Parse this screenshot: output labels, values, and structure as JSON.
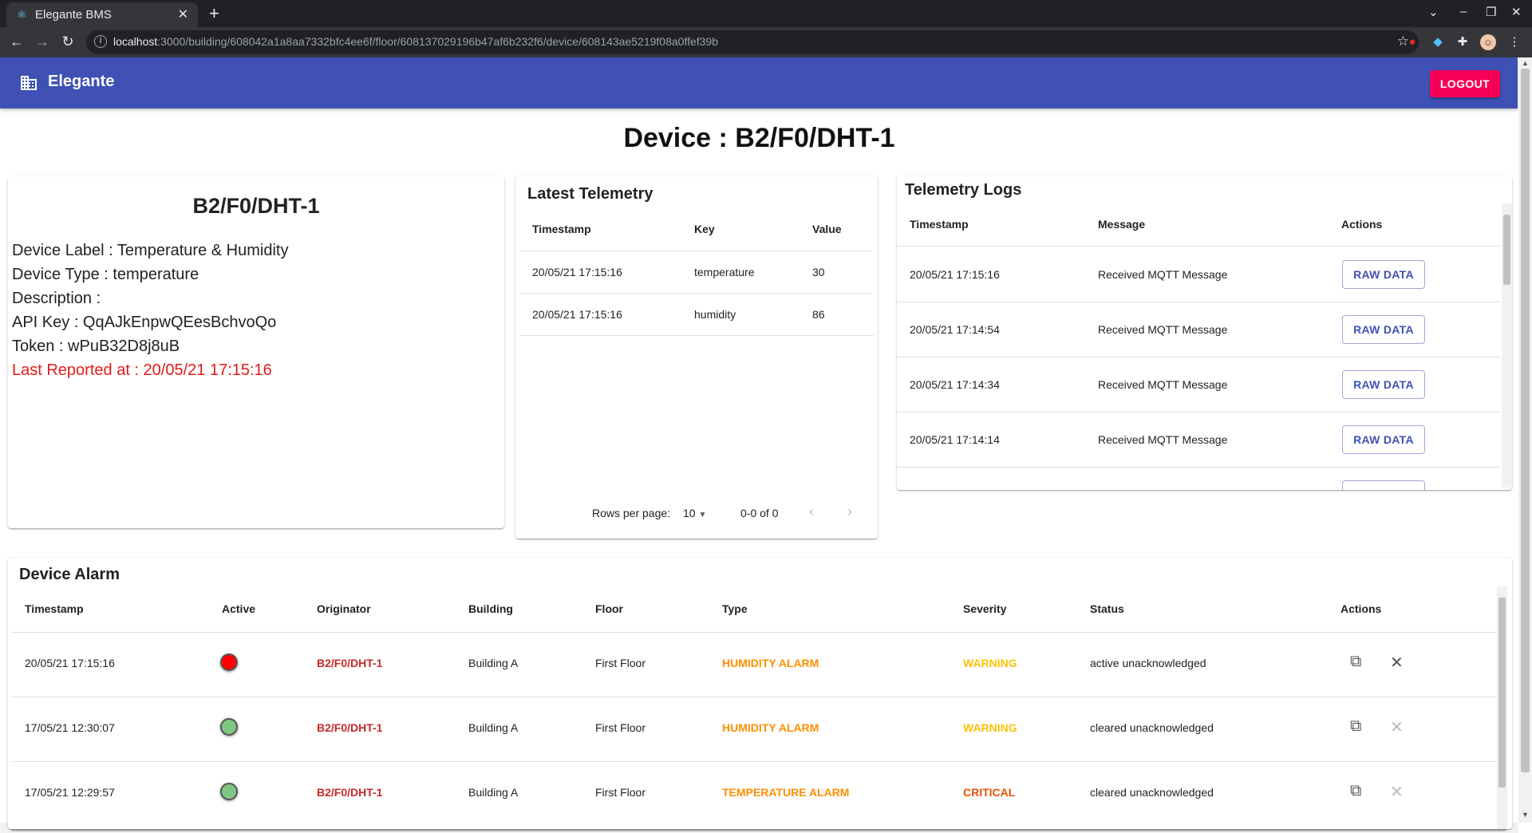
{
  "browser": {
    "tab_title": "Elegante BMS",
    "url_host": "localhost",
    "url_path": ":3000/building/608042a1a8aa7332bfc4ee6f/floor/608137029196b47af6b232f6/device/608143ae5219f08a0ffef39b"
  },
  "appbar": {
    "brand": "Elegante",
    "logout_label": "LOGOUT"
  },
  "page_title": "Device : B2/F0/DHT-1",
  "device": {
    "name": "B2/F0/DHT-1",
    "label_line": "Device Label : Temperature & Humidity",
    "type_line": "Device Type : temperature",
    "description_line": "Description :",
    "api_key_line": "API Key : QqAJkEnpwQEesBchvoQo",
    "token_line": "Token : wPuB32D8j8uB",
    "last_reported_line": "Last Reported at : 20/05/21 17:15:16"
  },
  "telemetry": {
    "title": "Latest Telemetry",
    "columns": [
      "Timestamp",
      "Key",
      "Value"
    ],
    "rows": [
      {
        "timestamp": "20/05/21 17:15:16",
        "key": "temperature",
        "value": "30"
      },
      {
        "timestamp": "20/05/21 17:15:16",
        "key": "humidity",
        "value": "86"
      }
    ],
    "rows_per_page_label": "Rows per page:",
    "rows_per_page_value": "10",
    "range_label": "0-0 of 0"
  },
  "logs": {
    "title": "Telemetry Logs",
    "columns": [
      "Timestamp",
      "Message",
      "Actions"
    ],
    "button_label": "RAW DATA",
    "rows": [
      {
        "timestamp": "20/05/21 17:15:16",
        "message": "Received MQTT Message"
      },
      {
        "timestamp": "20/05/21 17:14:54",
        "message": "Received MQTT Message"
      },
      {
        "timestamp": "20/05/21 17:14:34",
        "message": "Received MQTT Message"
      },
      {
        "timestamp": "20/05/21 17:14:14",
        "message": "Received MQTT Message"
      }
    ]
  },
  "alarms": {
    "title": "Device Alarm",
    "columns": [
      "Timestamp",
      "Active",
      "Originator",
      "Building",
      "Floor",
      "Type",
      "Severity",
      "Status",
      "Actions"
    ],
    "colors": {
      "active": "#ff0000",
      "inactive": "#81c784"
    },
    "rows": [
      {
        "timestamp": "20/05/21 17:15:16",
        "active": true,
        "originator": "B2/F0/DHT-1",
        "building": "Building A",
        "floor": "First Floor",
        "type": "HUMIDITY ALARM",
        "severity": "WARNING",
        "status": "active unacknowledged"
      },
      {
        "timestamp": "17/05/21 12:30:07",
        "active": false,
        "originator": "B2/F0/DHT-1",
        "building": "Building A",
        "floor": "First Floor",
        "type": "HUMIDITY ALARM",
        "severity": "WARNING",
        "status": "cleared unacknowledged"
      },
      {
        "timestamp": "17/05/21 12:29:57",
        "active": false,
        "originator": "B2/F0/DHT-1",
        "building": "Building A",
        "floor": "First Floor",
        "type": "TEMPERATURE ALARM",
        "severity": "CRITICAL",
        "status": "cleared unacknowledged"
      }
    ]
  }
}
